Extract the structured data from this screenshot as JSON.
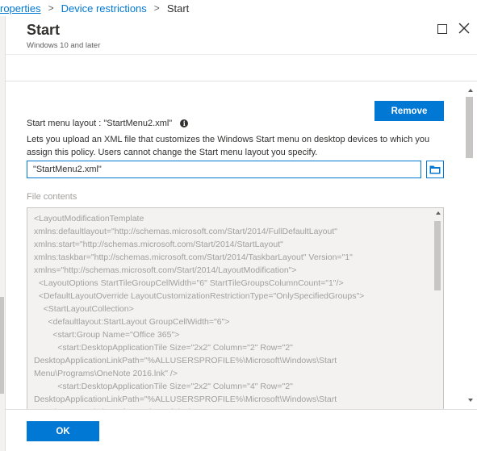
{
  "breadcrumb": {
    "items": [
      "roperties",
      "Device restrictions",
      "Start"
    ],
    "separator": ">"
  },
  "blade": {
    "title": "Start",
    "subtitle": "Windows 10 and later"
  },
  "start_menu": {
    "layout_label": "Start menu layout : \"StartMenu2.xml\"",
    "remove_label": "Remove",
    "description": "Lets you upload an XML file that customizes the Windows Start menu on desktop devices to which you assign this policy. Users cannot change the Start menu layout you specify.",
    "file_value": "\"StartMenu2.xml\"",
    "file_contents_label": "File contents",
    "file_contents": "<LayoutModificationTemplate\nxmlns:defaultlayout=\"http://schemas.microsoft.com/Start/2014/FullDefaultLayout\"\nxmlns:start=\"http://schemas.microsoft.com/Start/2014/StartLayout\"\nxmlns:taskbar=\"http://schemas.microsoft.com/Start/2014/TaskbarLayout\" Version=\"1\"\nxmlns=\"http://schemas.microsoft.com/Start/2014/LayoutModification\">\n  <LayoutOptions StartTileGroupCellWidth=\"6\" StartTileGroupsColumnCount=\"1\"/>\n  <DefaultLayoutOverride LayoutCustomizationRestrictionType=\"OnlySpecifiedGroups\">\n    <StartLayoutCollection>\n      <defaultlayout:StartLayout GroupCellWidth=\"6\">\n        <start:Group Name=\"Office 365\">\n          <start:DesktopApplicationTile Size=\"2x2\" Column=\"2\" Row=\"2\"\nDesktopApplicationLinkPath=\"%ALLUSERSPROFILE%\\Microsoft\\Windows\\Start\nMenu\\Programs\\OneNote 2016.lnk\" />\n          <start:DesktopApplicationTile Size=\"2x2\" Column=\"4\" Row=\"2\"\nDesktopApplicationLinkPath=\"%ALLUSERSPROFILE%\\Microsoft\\Windows\\Start\nMenu\\Programs\\Skype for Business.lnk\" />"
  },
  "footer": {
    "ok_label": "OK"
  },
  "icons": {
    "info": "info-icon",
    "folder": "folder-icon",
    "maximize": "maximize-icon",
    "close": "close-icon"
  },
  "colors": {
    "accent": "#0078d4",
    "text": "#323130",
    "muted": "#a19f9d"
  }
}
